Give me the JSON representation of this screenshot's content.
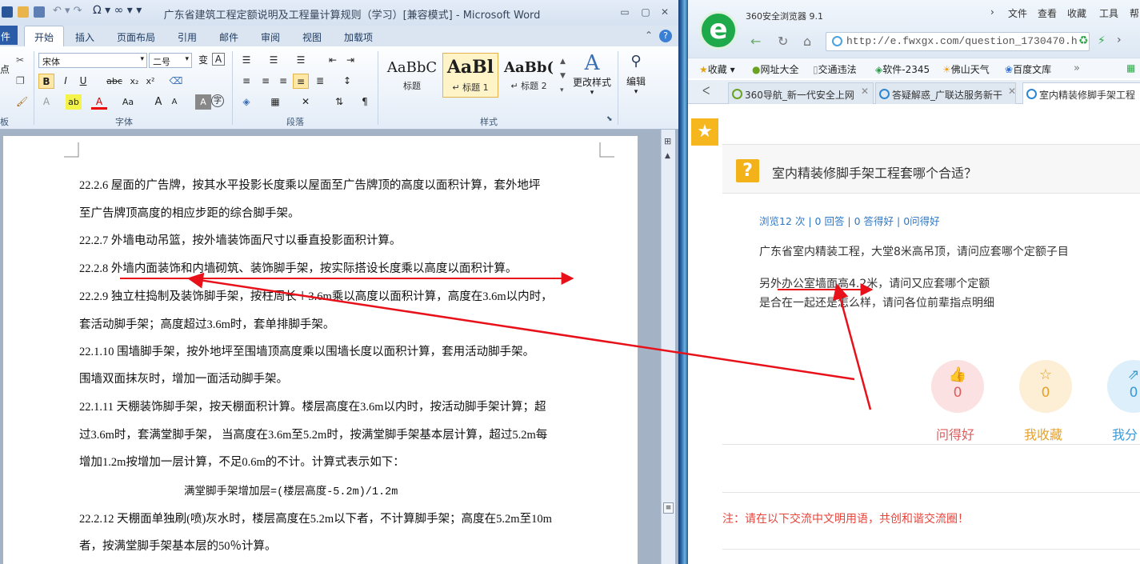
{
  "word": {
    "title": "广东省建筑工程定额说明及工程量计算规则（学习）[兼容模式] - Microsoft Word",
    "tabs": [
      "件",
      "开始",
      "插入",
      "页面布局",
      "引用",
      "邮件",
      "审阅",
      "视图",
      "加载项"
    ],
    "font_name": "宋体",
    "font_size": "二号",
    "style_samples": [
      {
        "sample": "AaBbC",
        "name": "标题"
      },
      {
        "sample": "AaBl",
        "name": "↵ 标题 1"
      },
      {
        "sample": "AaBb(",
        "name": "↵ 标题 2"
      }
    ],
    "change_styles": "更改样式",
    "edit": "编辑",
    "group_labels": {
      "clipboard": "板",
      "font": "字体",
      "paragraph": "段落",
      "styles": "样式"
    },
    "doc_lines": [
      "22.2.6  屋面的广告牌，按其水平投影长度乘以屋面至广告牌顶的高度以面积计算，套外地坪",
      "至广告牌顶高度的相应步距的综合脚手架。",
      "22.2.7  外墙电动吊篮，按外墙装饰面尺寸以垂直投影面积计算。",
      "22.2.8  外墙内面装饰和内墙砌筑、装饰脚手架，按实际搭设长度乘以高度以面积计算。",
      "22.2.9  独立柱捣制及装饰脚手架，按柱周长＋3.6m乘以高度以面积计算，高度在3.6m以内时，",
      "套活动脚手架；高度超过3.6m时，套单排脚手架。",
      "22.1.10    围墙脚手架，按外地坪至围墙顶高度乘以围墙长度以面积计算，套用活动脚手架。",
      "围墙双面抹灰时，增加一面活动脚手架。",
      "22.1.11  天棚装饰脚手架，按天棚面积计算。楼层高度在3.6m以内时，按活动脚手架计算；超",
      "过3.6m时，套满堂脚手架，  当高度在3.6m至5.2m时，按满堂脚手架基本层计算，超过5.2m每",
      "增加1.2m按增加一层计算，不足0.6m的不计。计算式表示如下：",
      "满堂脚手架增加层=(楼层高度-5.2m)/1.2m",
      "22.2.12  天棚面单独刷(喷)灰水时，楼层高度在5.2m以下者，不计算脚手架；高度在5.2m至10m",
      "者，按满堂脚手架基本层的50％计算。"
    ]
  },
  "browser": {
    "app_name": "360安全浏览器 9.1",
    "menu": [
      "文件",
      "查看",
      "收藏",
      "工具",
      "帮"
    ],
    "address": "http://e.fwxgx.com/question_1730470.h",
    "bookmarks": [
      "收藏",
      "网址大全",
      "交通违法",
      "软件-2345",
      "佛山天气",
      "百度文库"
    ],
    "tabs": [
      {
        "label": "360导航_新一代安全上网"
      },
      {
        "label": "答疑解惑_广联达服务新干"
      },
      {
        "label": "室内精装修脚手架工程"
      }
    ],
    "question": {
      "title": "室内精装修脚手架工程套哪个合适？",
      "stats": "浏览12 次 | 0 回答 | 0 答得好 | 0问得好",
      "body": [
        "广东省室内精装工程，大堂8米高吊顶，请问应套哪个定额子目",
        "另外办公室墙面高4.2米，请问又应套哪个定额",
        "是合在一起还是怎么样，请问各位前辈指点明细"
      ]
    },
    "actions": [
      {
        "label": "问得好",
        "count": "0",
        "color": "#e05c5c",
        "bg": "#fbe1e1"
      },
      {
        "label": "我收藏",
        "count": "0",
        "color": "#e6a12a",
        "bg": "#fcefd6"
      },
      {
        "label": "我分",
        "count": "0",
        "color": "#3a9ad9",
        "bg": "#ddeffb"
      }
    ],
    "notice": "注：请在以下交流中文明用语，共创和谐交流圈！"
  },
  "colors": {
    "annotation": "#e8111a",
    "word_blue": "#2a5ca8"
  }
}
